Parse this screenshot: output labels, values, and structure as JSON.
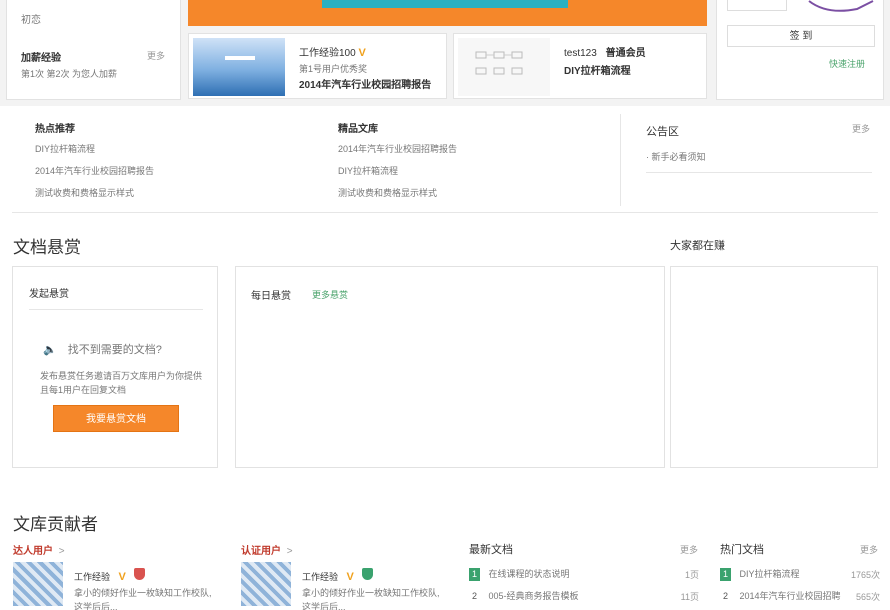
{
  "top": {
    "left_panel": {
      "top_text": "初恋",
      "join_title": "加薪经验",
      "join_more": "更多",
      "join_sub": "第1次  第2次  为您人加薪"
    },
    "banner": {
      "button_label": ""
    },
    "doc_card_1": {
      "author": "工作经验100",
      "author_badge": "V",
      "author_sub": "第1号用户优秀奖",
      "doc_title": "2014年汽车行业校园招聘报告"
    },
    "doc_card_2": {
      "author": "test123",
      "author_tag": "普通会员",
      "doc_title": "DIY拉杆箱流程"
    },
    "right_panel": {
      "signin_label": "签 到",
      "quick_link": "快速注册"
    }
  },
  "recommend": {
    "col1": {
      "title": "热点推荐",
      "items": [
        "DIY拉杆箱流程",
        "2014年汽车行业校园招聘报告",
        "测试收费和费格显示样式"
      ]
    },
    "col2": {
      "title": "精品文库",
      "items": [
        "2014年汽车行业校园招聘报告",
        "DIY拉杆箱流程",
        "测试收费和费格显示样式"
      ]
    },
    "notice": {
      "title": "公告区",
      "more": "更多",
      "items": [
        "· 新手必看须知"
      ]
    }
  },
  "reward": {
    "section_title": "文档悬赏",
    "earning_title": "大家都在赚",
    "post": {
      "title": "发起悬赏",
      "not_found": "找不到需要的文档?",
      "desc_line1": "发布悬赏任务邀请百万文库用户为你提供",
      "desc_line2": "且每1用户在回复文档",
      "button": "我要悬赏文档"
    },
    "daily": {
      "title": "每日悬赏",
      "tag": "更多悬赏"
    }
  },
  "contributors": {
    "section_title": "文库贡献者",
    "expert": {
      "title": "达人用户",
      "arrow": ">",
      "name": "工作经验",
      "badge": "V",
      "desc_line1": "拿小的倾好作业一枚缺知工作校队,",
      "desc_line2": "这学后后..."
    },
    "certified": {
      "title": "认证用户",
      "arrow": ">",
      "name": "工作经验",
      "badge": "V",
      "desc_line1": "拿小的倾好作业一枚缺知工作校队,",
      "desc_line2": "这学后后..."
    },
    "latest": {
      "title": "最新文档",
      "more": "更多",
      "items": [
        {
          "rank": "1",
          "name": "在线课程的状态说明",
          "count": "1页"
        },
        {
          "rank": "2",
          "name": "005-经典商务报告模板",
          "count": "11页"
        }
      ]
    },
    "hot": {
      "title": "热门文档",
      "more": "更多",
      "items": [
        {
          "rank": "1",
          "name": "DIY拉杆箱流程",
          "count": "1765次"
        },
        {
          "rank": "2",
          "name": "2014年汽车行业校园招聘",
          "count": "565次"
        }
      ]
    }
  },
  "colors": {
    "orange": "#f5872a",
    "teal": "#2bb0c2",
    "green": "#3aa26e",
    "shield_red": "#d9534f",
    "shield_green": "#3aa26e"
  }
}
